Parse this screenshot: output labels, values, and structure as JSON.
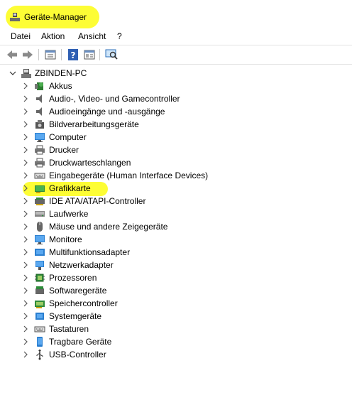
{
  "window": {
    "title": "Geräte-Manager",
    "title_icon": "device-manager-icon"
  },
  "menu": {
    "items": [
      "Datei",
      "Aktion",
      "Ansicht",
      "?"
    ]
  },
  "toolbar": {
    "buttons": [
      "back-arrow-icon",
      "forward-arrow-icon",
      "properties-icon",
      "help-icon",
      "show-view-icon",
      "monitor-scan-icon"
    ]
  },
  "tree": {
    "root": {
      "label": "ZBINDEN-PC",
      "icon": "computer-icon",
      "expanded": true
    },
    "items": [
      {
        "label": "Akkus",
        "icon": "battery-icon"
      },
      {
        "label": "Audio-, Video- und Gamecontroller",
        "icon": "speaker-icon"
      },
      {
        "label": "Audioeingänge und -ausgänge",
        "icon": "speaker-icon"
      },
      {
        "label": "Bildverarbeitungsgeräte",
        "icon": "camera-icon"
      },
      {
        "label": "Computer",
        "icon": "monitor-icon"
      },
      {
        "label": "Drucker",
        "icon": "printer-icon"
      },
      {
        "label": "Druckwarteschlangen",
        "icon": "printer-icon"
      },
      {
        "label": "Eingabegeräte (Human Interface Devices)",
        "icon": "keyboard-icon"
      },
      {
        "label": "Grafikkarte",
        "icon": "graphics-card-icon",
        "highlighted": true
      },
      {
        "label": "IDE ATA/ATAPI-Controller",
        "icon": "controller-icon"
      },
      {
        "label": "Laufwerke",
        "icon": "drive-icon"
      },
      {
        "label": "Mäuse und andere Zeigegeräte",
        "icon": "mouse-icon"
      },
      {
        "label": "Monitore",
        "icon": "monitor-icon"
      },
      {
        "label": "Multifunktionsadapter",
        "icon": "adapter-icon"
      },
      {
        "label": "Netzwerkadapter",
        "icon": "network-icon"
      },
      {
        "label": "Prozessoren",
        "icon": "processor-icon"
      },
      {
        "label": "Softwaregeräte",
        "icon": "software-device-icon"
      },
      {
        "label": "Speichercontroller",
        "icon": "storage-controller-icon"
      },
      {
        "label": "Systemgeräte",
        "icon": "system-device-icon"
      },
      {
        "label": "Tastaturen",
        "icon": "keyboard-icon"
      },
      {
        "label": "Tragbare Geräte",
        "icon": "portable-device-icon"
      },
      {
        "label": "USB-Controller",
        "icon": "usb-icon"
      }
    ]
  },
  "colors": {
    "highlight": "#fdfd35",
    "accent": "#1e6fc8"
  }
}
